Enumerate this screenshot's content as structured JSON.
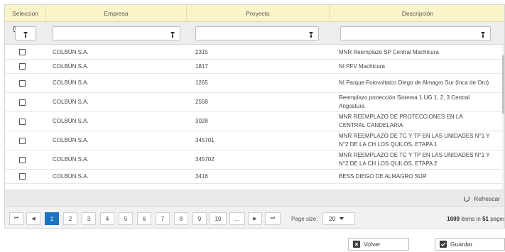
{
  "columns": {
    "seleccion": "Seleccion",
    "empresa": "Empresa",
    "proyecto": "Proyecto",
    "descripcion": "Descripción"
  },
  "filters": {
    "empresa_value": "",
    "proyecto_value": "",
    "descripcion_value": ""
  },
  "rows": [
    {
      "empresa": "COLBÚN S.A.",
      "proyecto": "2315",
      "descripcion": "MNR Reemplazo SP Central Machicura"
    },
    {
      "empresa": "COLBÚN S.A.",
      "proyecto": "1817",
      "descripcion": "NI PFV Machicura"
    },
    {
      "empresa": "COLBÚN S.A.",
      "proyecto": "1265",
      "descripcion": "NI Parque Fotovoltaico Diego de Almagro Sur (Inca de Oro)"
    },
    {
      "empresa": "COLBÚN S.A.",
      "proyecto": "2558",
      "descripcion": "Reemplazo protección Sistema 1 UG 1, 2, 3 Central Angostura"
    },
    {
      "empresa": "COLBÚN S.A.",
      "proyecto": "3028",
      "descripcion": "MNR REEMPLAZO DE PROTECCIONES EN LA CENTRAL CANDELARIA"
    },
    {
      "empresa": "COLBÚN S.A.",
      "proyecto": "345701",
      "descripcion": "MNR REEMPLAZO DE TC Y TP EN LAS UNIDADES N°1 Y N°2 DE LA CH LOS QUILOS, ETAPA 1"
    },
    {
      "empresa": "COLBÚN S.A.",
      "proyecto": "345702",
      "descripcion": "MNR REEMPLAZO DE TC Y TP EN LAS UNIDADES N°1 Y N°2 DE LA CH LOS QUILOS, ETAPA 2"
    },
    {
      "empresa": "COLBÚN S.A.",
      "proyecto": "3416",
      "descripcion": "BESS DIEGO DE ALMAGRO SUR"
    }
  ],
  "toolbar": {
    "refresh_label": "Refrescar"
  },
  "pager": {
    "first": "⏮",
    "prev": "◀",
    "next": "▶",
    "last": "⏭",
    "pages": [
      "1",
      "2",
      "3",
      "4",
      "5",
      "6",
      "7",
      "8",
      "9",
      "10",
      "..."
    ],
    "current_page": "1",
    "page_size_label": "Page size:",
    "page_size_value": "20",
    "items_total": "1009",
    "items_text": " items in ",
    "pages_total": "51",
    "pages_text": " pages"
  },
  "actions": {
    "volver_label": "Volver",
    "guardar_label": "Guardar"
  },
  "colors": {
    "header_bg": "#fbf4c9",
    "accent": "#1a73c2",
    "filter_bg": "#ededed",
    "toolbar_bg": "#eaeaea"
  },
  "icons": {
    "filter": "funnel-icon",
    "refresh": "refresh-icon",
    "volver": "back-icon",
    "guardar": "checkbox-save-icon"
  }
}
